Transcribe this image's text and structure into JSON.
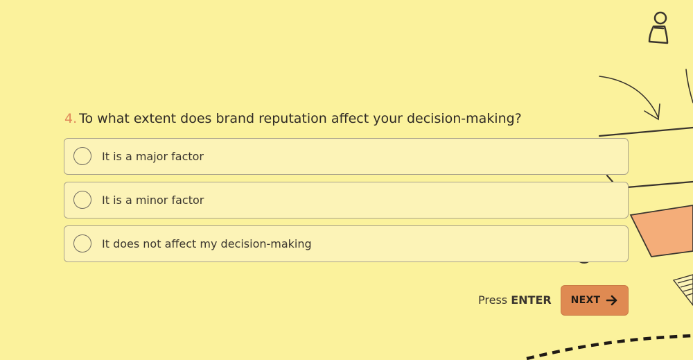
{
  "colors": {
    "background": "#fbf29c",
    "option_background": "#fcf3b7",
    "accent": "#df8a52",
    "question_number": "#e0895a",
    "decoration_fill": "#f4ad79"
  },
  "question": {
    "number": "4.",
    "text": "To what extent does brand reputation affect your decision-making?"
  },
  "options": [
    {
      "label": "It is a major factor"
    },
    {
      "label": "It is a minor factor"
    },
    {
      "label": "It does not affect my decision-making"
    }
  ],
  "footer": {
    "hint_prefix": "Press",
    "hint_key": "ENTER",
    "next_label": "NEXT",
    "next_icon": "arrow-right-icon"
  },
  "decorations": {
    "illustration": "hand-drawn-sketch-illustration"
  }
}
